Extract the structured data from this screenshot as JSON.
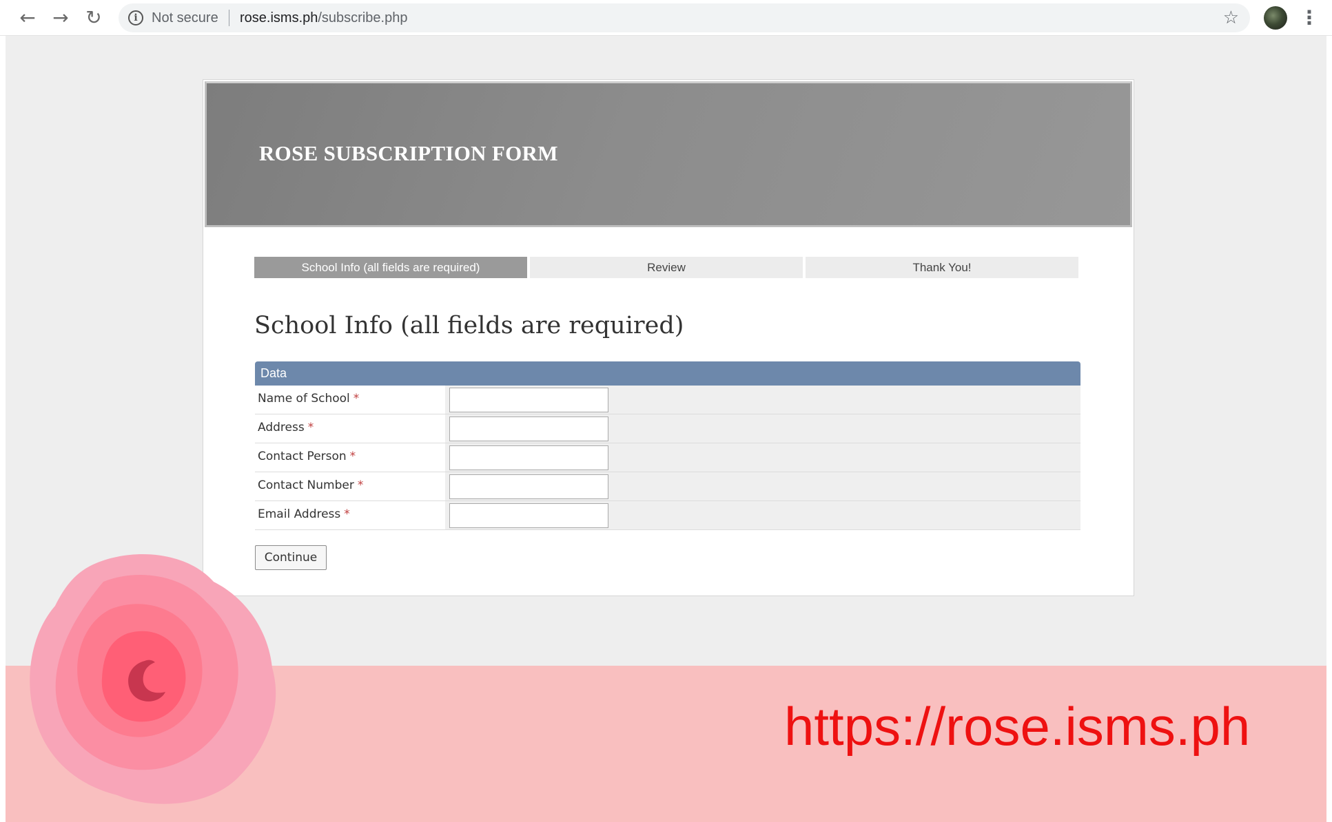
{
  "browser": {
    "security_label": "Not secure",
    "url_host": "rose.isms.ph",
    "url_path": "/subscribe.php",
    "back_icon": "arrow-left",
    "forward_icon": "arrow-right",
    "reload_icon": "reload",
    "bookmark_icon": "star-outline",
    "menu_icon": "kebab-vertical"
  },
  "form": {
    "header_title": "ROSE SUBSCRIPTION FORM",
    "steps": [
      {
        "label": "School Info (all fields are required)",
        "active": true
      },
      {
        "label": "Review",
        "active": false
      },
      {
        "label": "Thank You!",
        "active": false
      }
    ],
    "section_title": "School Info (all fields are required)",
    "table_header": "Data",
    "required_mark": "*",
    "fields": [
      {
        "label": "Name of School",
        "value": ""
      },
      {
        "label": "Address",
        "value": ""
      },
      {
        "label": "Contact Person",
        "value": ""
      },
      {
        "label": "Contact Number",
        "value": ""
      },
      {
        "label": "Email Address",
        "value": ""
      }
    ],
    "continue_label": "Continue"
  },
  "banner": {
    "url_text": "https://rose.isms.ph"
  },
  "colors": {
    "header_bg": "#8c8c8c",
    "active_step": "#9a9a9a",
    "table_header": "#6d88ab",
    "pink_band": "#f9bfbf",
    "banner_text": "#ee1111"
  }
}
